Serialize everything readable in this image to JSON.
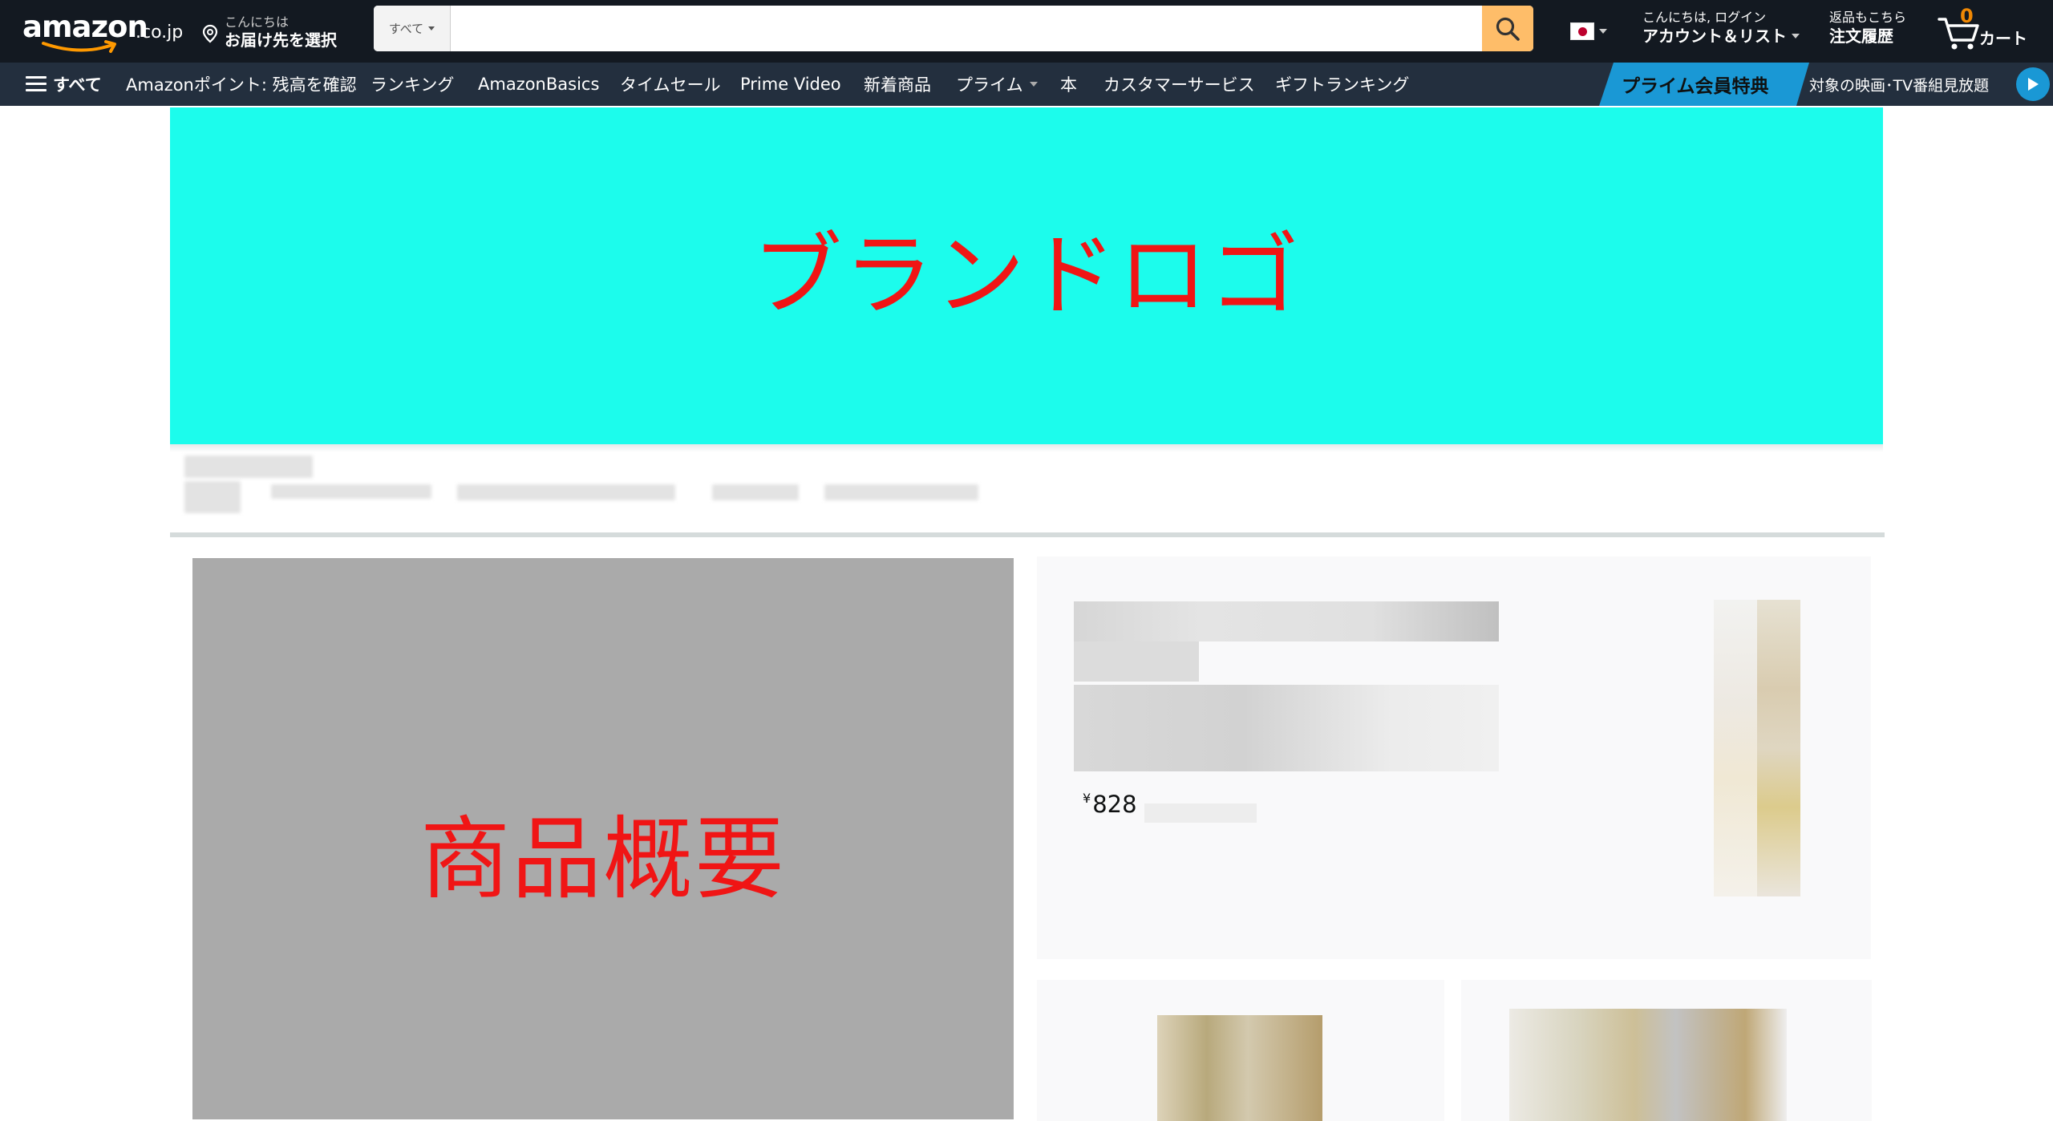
{
  "header": {
    "logo_text": "amazon",
    "logo_tld": ".co.jp",
    "deliver_line1": "こんにちは",
    "deliver_line2": "お届け先を選択",
    "search_category": "すべて",
    "search_placeholder": "",
    "account_line1": "こんにちは, ログイン",
    "account_line2": "アカウント＆リスト",
    "orders_line1": "返品もこちら",
    "orders_line2": "注文履歴",
    "cart_count": "0",
    "cart_label": "カート"
  },
  "subnav": {
    "all_label": "すべて",
    "items": [
      "Amazonポイント: 残高を確認",
      "ランキング",
      "AmazonBasics",
      "タイムセール",
      "Prime Video",
      "新着商品",
      "プライム",
      "本",
      "カスタマーサービス",
      "ギフトランキング"
    ],
    "promo_left": "プライム会員特典",
    "promo_right": "対象の映画･TV番組見放題"
  },
  "page": {
    "brand_logo_placeholder": "ブランドロゴ",
    "product_overview_placeholder": "商品概要",
    "product_price_symbol": "¥",
    "product_price_value": "828"
  },
  "colors": {
    "nav_bg": "#131921",
    "subnav_bg": "#232f3e",
    "search_button": "#febd69",
    "brand_banner": "#1cfcec",
    "placeholder_text": "#f01515",
    "overview_bg": "#aaaaaa",
    "prime_blue": "#1a98d5"
  }
}
